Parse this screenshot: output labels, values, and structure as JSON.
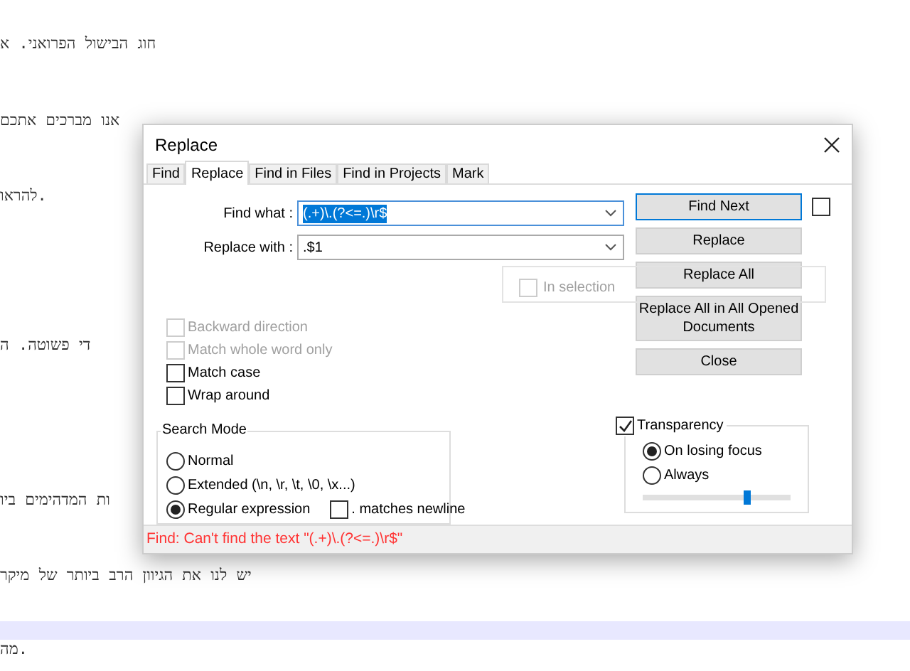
{
  "editor": {
    "lines": [
      {
        "text": "חוג הבישול הפרואני. א",
        "current": false
      },
      {
        "text": "אנו מברכים אתכם",
        "current": false
      },
      {
        "text": "להראו.",
        "current": false
      },
      {
        "text": "די פשוטה. ה",
        "current": false
      },
      {
        "text": "ות המדהימים ביו",
        "current": false
      },
      {
        "text": "יש לנו את הגיוון הרב ביותר של מיקר",
        "current": false
      },
      {
        "current": true
      },
      {
        "text": "מה.",
        "current": false
      }
    ]
  },
  "dialog": {
    "title": "Replace",
    "tabs": [
      {
        "label": "Find",
        "selected": false
      },
      {
        "label": "Replace",
        "selected": true
      },
      {
        "label": "Find in Files",
        "selected": false
      },
      {
        "label": "Find in Projects",
        "selected": false
      },
      {
        "label": "Mark",
        "selected": false
      }
    ],
    "find_what": {
      "label": "Find what :",
      "value": "(.+)\\.(?<=.)\\r$",
      "selected": true
    },
    "replace_with": {
      "label": "Replace with :",
      "value": ".$1",
      "selected": false
    },
    "buttons": [
      {
        "label": "Find Next",
        "focused": true
      },
      {
        "label": "Replace",
        "focused": false
      },
      {
        "label": "Replace All",
        "focused": false
      },
      {
        "label": "Replace All in All Opened Documents",
        "focused": false
      },
      {
        "label": "Close",
        "focused": false
      }
    ],
    "side_checkbox": {
      "checked": false
    },
    "in_selection": {
      "label": "In selection",
      "checked": false,
      "disabled": true
    },
    "options": [
      {
        "label": "Backward direction",
        "checked": false,
        "disabled": true
      },
      {
        "label": "Match whole word only",
        "checked": false,
        "disabled": true
      },
      {
        "label": "Match case",
        "checked": false,
        "disabled": false
      },
      {
        "label": "Wrap around",
        "checked": false,
        "disabled": false
      }
    ],
    "search_mode": {
      "title": "Search Mode",
      "modes": [
        {
          "label": "Normal",
          "selected": false
        },
        {
          "label": "Extended (\\n, \\r, \\t, \\0, \\x...)",
          "selected": false
        },
        {
          "label": "Regular expression",
          "selected": true
        }
      ],
      "dot_newline": {
        "label": ". matches newline",
        "checked": false
      }
    },
    "transparency": {
      "label": "Transparency",
      "checked": true,
      "modes": [
        {
          "label": "On losing focus",
          "selected": true
        },
        {
          "label": "Always",
          "selected": false
        }
      ],
      "level": 0.7
    },
    "status": "Find: Can't find the text \"(.+)\\.(?<=.)\\r$\""
  }
}
